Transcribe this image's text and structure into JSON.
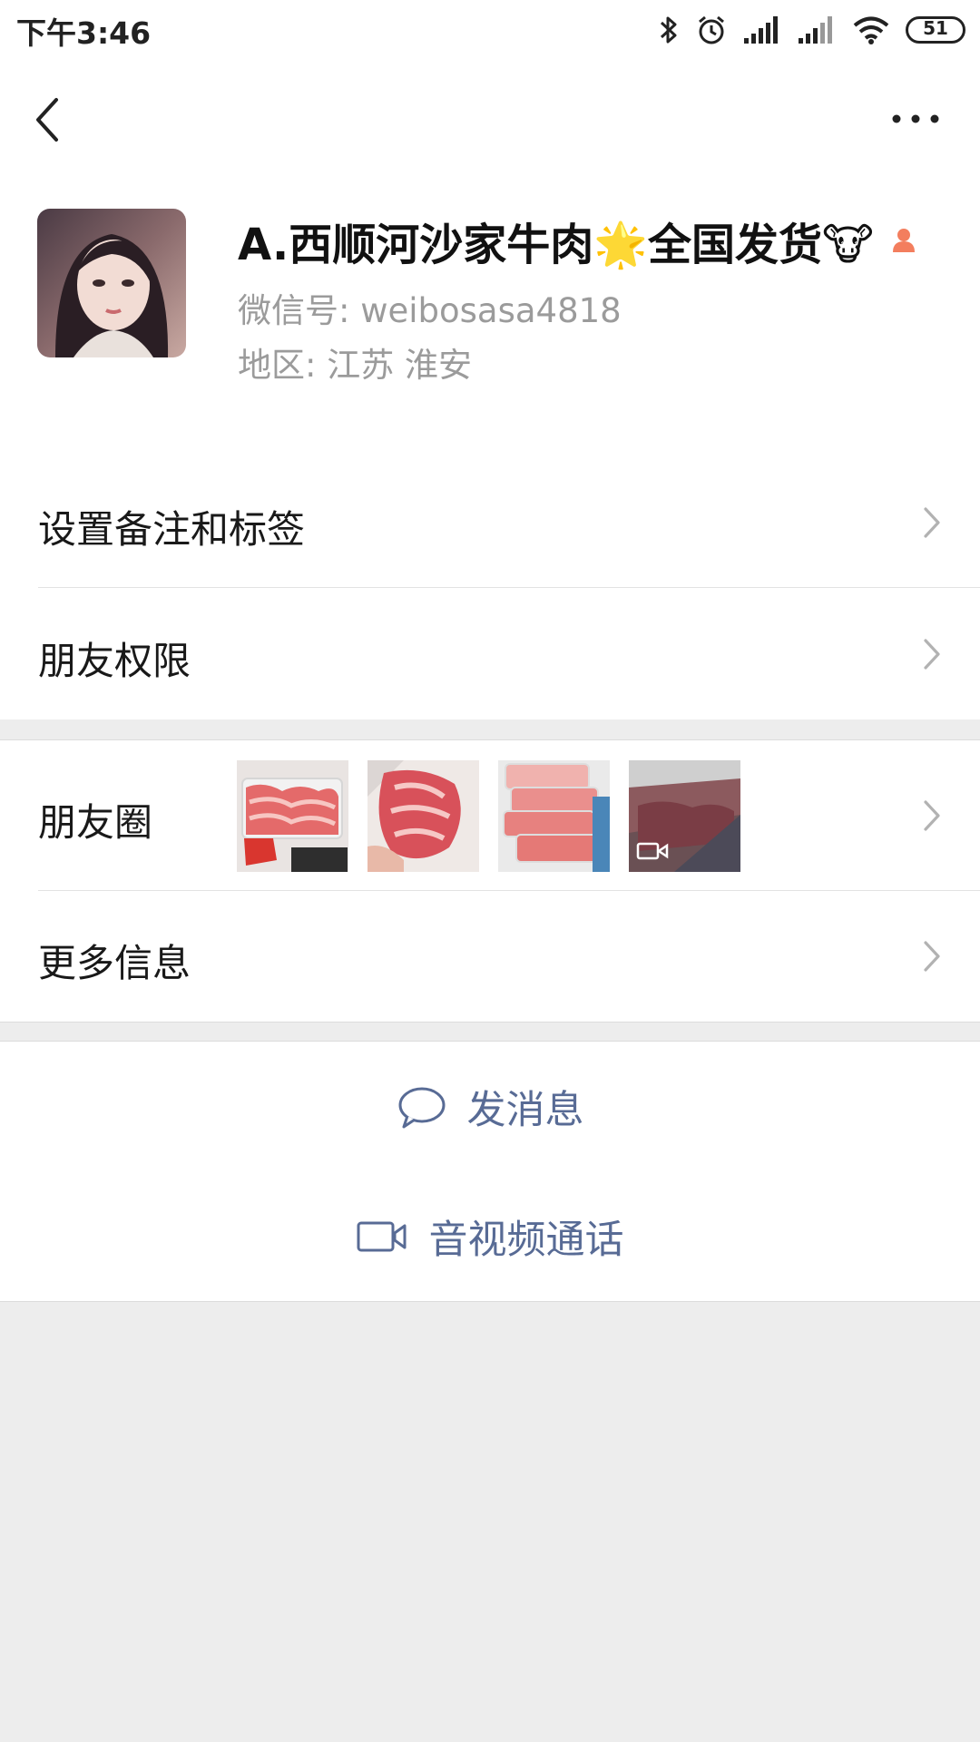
{
  "status_bar": {
    "time": "下午3:46",
    "battery": "51",
    "icons": [
      "bluetooth-icon",
      "alarm-icon",
      "signal-icon",
      "signal-icon-2",
      "wifi-icon",
      "battery-icon"
    ]
  },
  "nav": {
    "back_icon": "chevron-left-icon",
    "more_icon": "more-dots-icon"
  },
  "profile": {
    "name": "A.西顺河沙家牛肉🌟全国发货🐮",
    "gender_icon": "female-icon",
    "wechat_id": "微信号: weibosasa4818",
    "region": "地区: 江苏  淮安"
  },
  "menu": {
    "remark_tags": "设置备注和标签",
    "friend_permissions": "朋友权限",
    "moments": "朋友圈",
    "more_info": "更多信息"
  },
  "moments_thumbnails": [
    {
      "name": "moment-photo-1",
      "type": "image"
    },
    {
      "name": "moment-photo-2",
      "type": "image"
    },
    {
      "name": "moment-photo-3",
      "type": "image"
    },
    {
      "name": "moment-photo-4",
      "type": "video"
    }
  ],
  "actions": {
    "send_message": "发消息",
    "video_call": "音视频通话"
  },
  "colors": {
    "link": "#586b95",
    "background": "#ededed",
    "gender": "#f37e5e"
  }
}
